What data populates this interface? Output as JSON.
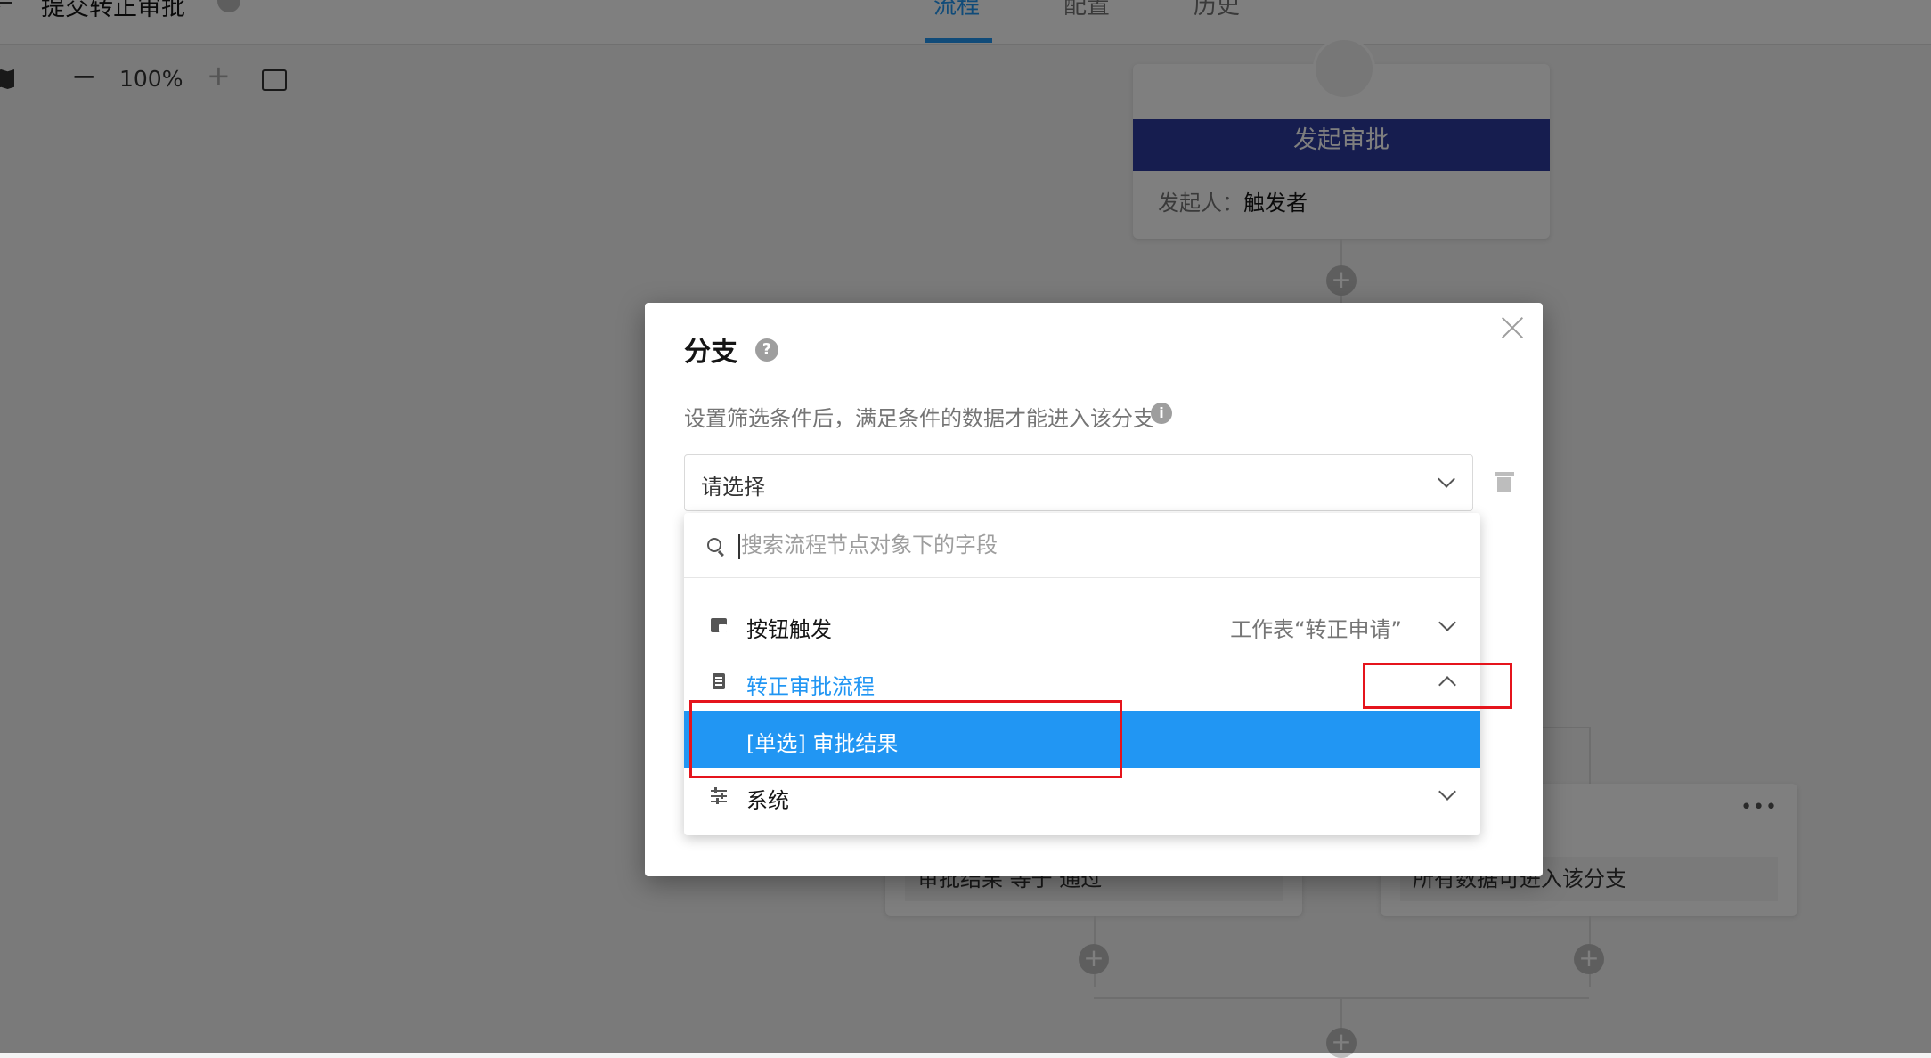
{
  "header": {
    "title": "提交转正审批",
    "tabs": [
      "流程",
      "配置",
      "历史"
    ],
    "active_tab_index": 0
  },
  "toolbar": {
    "zoom": "100%"
  },
  "flow": {
    "start_node": {
      "title": "发起审批",
      "initiator_label": "发起人：",
      "initiator_value": "触发者"
    },
    "branch_left_condition": "审批结果 等于 通过",
    "branch_right_condition": "所有数据可进入该分支"
  },
  "dialog": {
    "title": "分支",
    "description": "设置筛选条件后，满足条件的数据才能进入该分支",
    "select_placeholder": "请选择",
    "search_placeholder": "搜索流程节点对象下的字段",
    "items": [
      {
        "label": "按钮触发",
        "detail": "工作表“转正申请”",
        "expanded": false,
        "icon": "button-trigger-icon"
      },
      {
        "label": "转正审批流程",
        "detail": "",
        "expanded": true,
        "icon": "approval-doc-icon"
      },
      {
        "label": "[单选]  审批结果",
        "detail": "",
        "selected": true
      },
      {
        "label": "系统",
        "detail": "",
        "expanded": false,
        "icon": "sliders-icon"
      }
    ]
  },
  "colors": {
    "accent": "#2196f3",
    "start_node_header": "#2c3b9e",
    "highlight_box": "#e5141c",
    "purple_button": "#9c27b0"
  }
}
